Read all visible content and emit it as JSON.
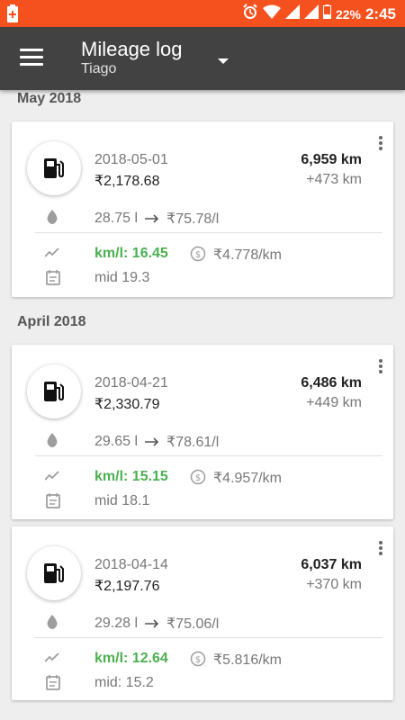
{
  "statusbar": {
    "battery": "22%",
    "time": "2:45"
  },
  "toolbar": {
    "title": "Mileage log",
    "subtitle": "Tiago"
  },
  "sections": [
    {
      "month": "May 2018"
    },
    {
      "month": "April 2018"
    }
  ],
  "entries": [
    {
      "date": "2018-05-01",
      "cost": "₹2,178.68",
      "odometer": "6,959 km",
      "distance": "+473 km",
      "liters": "28.75 l",
      "price": "₹75.78/l",
      "kml": "km/l: 16.45",
      "cost_per_km": "₹4.778/km",
      "note": "mid 19.3"
    },
    {
      "date": "2018-04-21",
      "cost": "₹2,330.79",
      "odometer": "6,486 km",
      "distance": "+449 km",
      "liters": "29.65 l",
      "price": "₹78.61/l",
      "kml": "km/l: 15.15",
      "cost_per_km": "₹4.957/km",
      "note": "mid 18.1"
    },
    {
      "date": "2018-04-14",
      "cost": "₹2,197.76",
      "odometer": "6,037 km",
      "distance": "+370 km",
      "liters": "29.28 l",
      "price": "₹75.06/l",
      "kml": "km/l: 12.64",
      "cost_per_km": "₹5.816/km",
      "note": "mid: 15.2"
    }
  ],
  "colors": {
    "statusbar": "#f4511e",
    "toolbar": "#424242",
    "accent_green": "#4caf50"
  }
}
